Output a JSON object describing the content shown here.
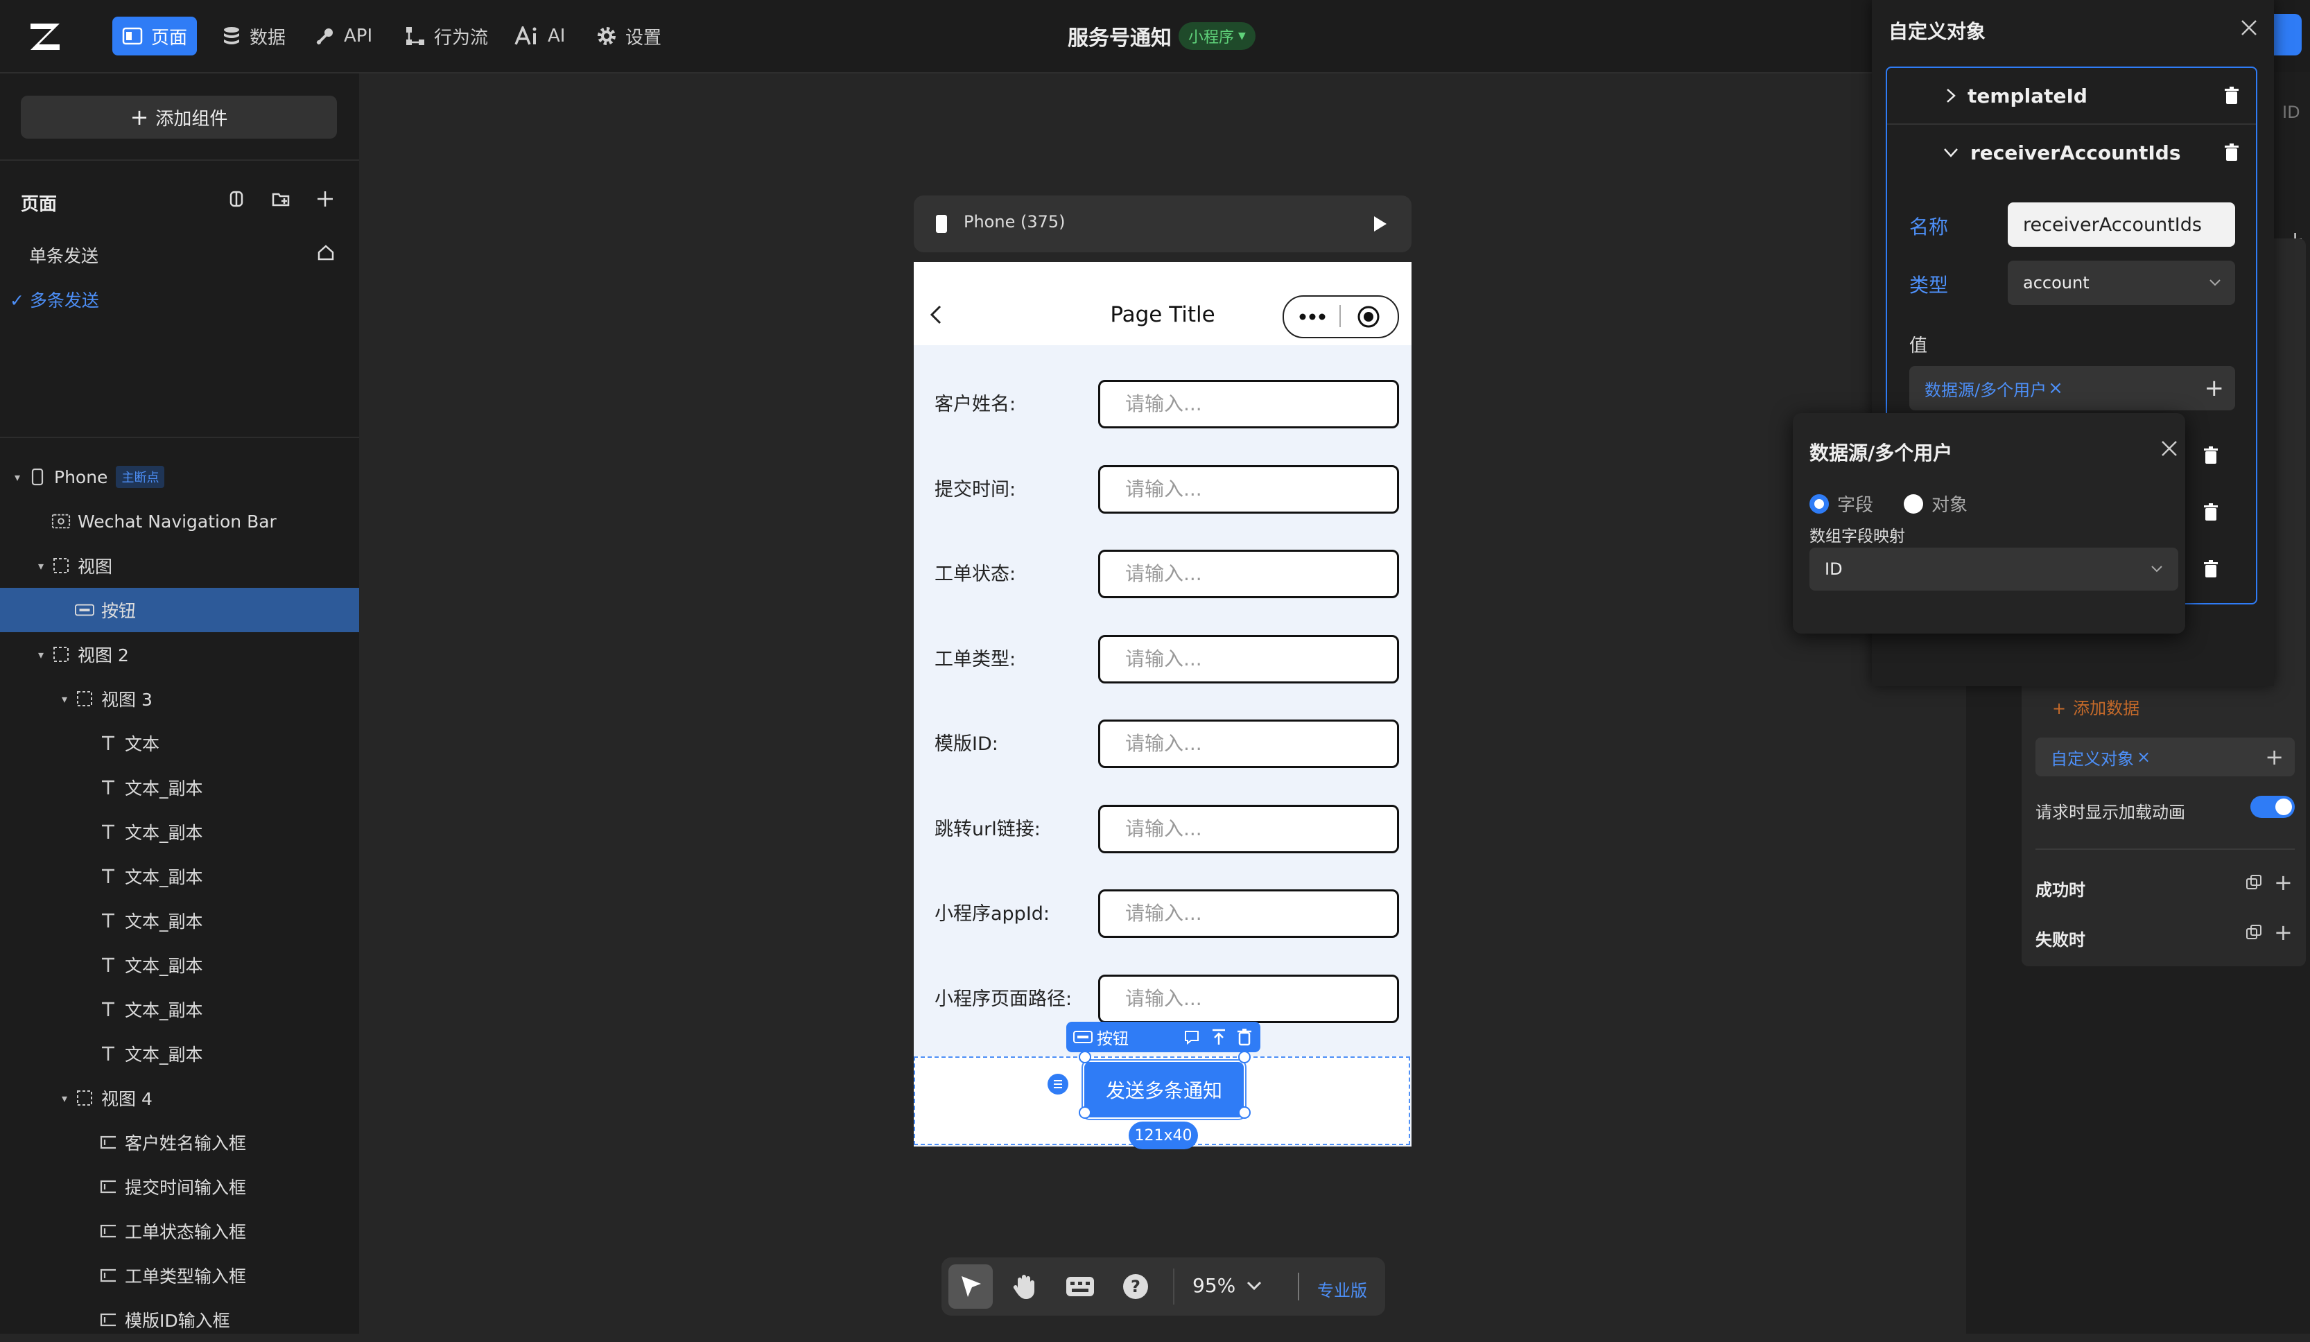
{
  "topbar": {
    "tabs": [
      {
        "label": "页面",
        "icon": "page-icon",
        "active": true
      },
      {
        "label": "数据",
        "icon": "database-icon",
        "active": false
      },
      {
        "label": "API",
        "icon": "api-icon",
        "active": false
      },
      {
        "label": "行为流",
        "icon": "flow-icon",
        "active": false
      },
      {
        "label": "AI",
        "icon": "ai-icon",
        "active": false
      },
      {
        "label": "设置",
        "icon": "gear-icon",
        "active": false
      }
    ],
    "app_title": "服务号通知",
    "app_type": "小程序"
  },
  "left_panel": {
    "add_component": "添加组件",
    "pages_title": "页面",
    "pages": [
      {
        "label": "单条发送",
        "selected": false
      },
      {
        "label": "多条发送",
        "selected": true
      }
    ],
    "tree": [
      {
        "label": "Phone",
        "badge": "主断点",
        "indent": 0,
        "caret": "▾",
        "icon": "phone-icon"
      },
      {
        "label": "Wechat Navigation Bar",
        "indent": 1,
        "caret": "",
        "icon": "navbar-icon"
      },
      {
        "label": "视图",
        "indent": 1,
        "caret": "▾",
        "icon": "view-icon"
      },
      {
        "label": "按钮",
        "indent": 2,
        "caret": "",
        "icon": "button-icon",
        "selected": true
      },
      {
        "label": "视图 2",
        "indent": 1,
        "caret": "▾",
        "icon": "view-icon"
      },
      {
        "label": "视图 3",
        "indent": 2,
        "caret": "▾",
        "icon": "view-icon"
      },
      {
        "label": "文本",
        "indent": 3,
        "caret": "",
        "icon": "text-icon"
      },
      {
        "label": "文本_副本",
        "indent": 3,
        "caret": "",
        "icon": "text-icon"
      },
      {
        "label": "文本_副本",
        "indent": 3,
        "caret": "",
        "icon": "text-icon"
      },
      {
        "label": "文本_副本",
        "indent": 3,
        "caret": "",
        "icon": "text-icon"
      },
      {
        "label": "文本_副本",
        "indent": 3,
        "caret": "",
        "icon": "text-icon"
      },
      {
        "label": "文本_副本",
        "indent": 3,
        "caret": "",
        "icon": "text-icon"
      },
      {
        "label": "文本_副本",
        "indent": 3,
        "caret": "",
        "icon": "text-icon"
      },
      {
        "label": "文本_副本",
        "indent": 3,
        "caret": "",
        "icon": "text-icon"
      },
      {
        "label": "视图 4",
        "indent": 2,
        "caret": "▾",
        "icon": "view-icon"
      },
      {
        "label": "客户姓名输入框",
        "indent": 3,
        "caret": "",
        "icon": "input-icon"
      },
      {
        "label": "提交时间输入框",
        "indent": 3,
        "caret": "",
        "icon": "input-icon"
      },
      {
        "label": "工单状态输入框",
        "indent": 3,
        "caret": "",
        "icon": "input-icon"
      },
      {
        "label": "工单类型输入框",
        "indent": 3,
        "caret": "",
        "icon": "input-icon"
      },
      {
        "label": "模版ID输入框",
        "indent": 3,
        "caret": "",
        "icon": "input-icon"
      }
    ]
  },
  "canvas": {
    "device_label": "Phone (375)",
    "page_title": "Page Title",
    "form": [
      {
        "label": "客户姓名:",
        "placeholder": "请输入..."
      },
      {
        "label": "提交时间:",
        "placeholder": "请输入..."
      },
      {
        "label": "工单状态:",
        "placeholder": "请输入..."
      },
      {
        "label": "工单类型:",
        "placeholder": "请输入..."
      },
      {
        "label": "模版ID:",
        "placeholder": "请输入..."
      },
      {
        "label": "跳转url链接:",
        "placeholder": "请输入..."
      },
      {
        "label": "小程序appId:",
        "placeholder": "请输入..."
      },
      {
        "label": "小程序页面路径:",
        "placeholder": "请输入..."
      }
    ],
    "selection_label": "按钮",
    "send_button": "发送多条通知",
    "size_badge": "121x40",
    "zoom": "95%",
    "edition": "专业版"
  },
  "custom_object": {
    "title": "自定义对象",
    "items": [
      {
        "label": "templateId",
        "expanded": false
      },
      {
        "label": "receiverAccountIds",
        "expanded": true
      }
    ],
    "name_label": "名称",
    "name_value": "receiverAccountIds",
    "type_label": "类型",
    "type_value": "account",
    "value_label": "值",
    "value_tag": "数据源/多个用户"
  },
  "datasource_popup": {
    "title": "数据源/多个用户",
    "radio_field": "字段",
    "radio_object": "对象",
    "mapping_label": "数组字段映射",
    "mapping_value": "ID"
  },
  "right_panel": {
    "id_fragment": "ID",
    "add_data_partial": "添加数据",
    "custom_obj_tag": "自定义对象",
    "loading_label": "请求时显示加载动画",
    "success_label": "成功时",
    "fail_label": "失败时"
  },
  "colors": {
    "accent": "#2f7cf6",
    "green": "#5fd27a",
    "bg": "#262626"
  }
}
